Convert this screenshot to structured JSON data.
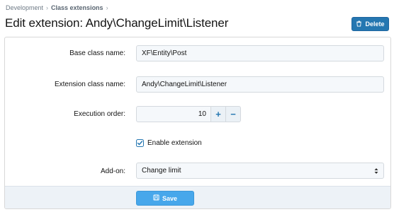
{
  "breadcrumb": {
    "items": [
      "Development",
      "Class extensions"
    ],
    "separator": "›"
  },
  "header": {
    "title": "Edit extension: Andy\\ChangeLimit\\Listener",
    "delete_label": "Delete"
  },
  "form": {
    "base_class": {
      "label": "Base class name:",
      "value": "XF\\Entity\\Post"
    },
    "extension_class": {
      "label": "Extension class name:",
      "value": "Andy\\ChangeLimit\\Listener"
    },
    "execution_order": {
      "label": "Execution order:",
      "value": "10",
      "increment_symbol": "+",
      "decrement_symbol": "−"
    },
    "enable_extension": {
      "label": "Enable extension",
      "checked": true
    },
    "addon": {
      "label": "Add-on:",
      "selected": "Change limit"
    },
    "save_label": "Save"
  },
  "colors": {
    "primary_button": "#2577b1",
    "save_button": "#47a7eb",
    "accent": "#2577b1"
  }
}
